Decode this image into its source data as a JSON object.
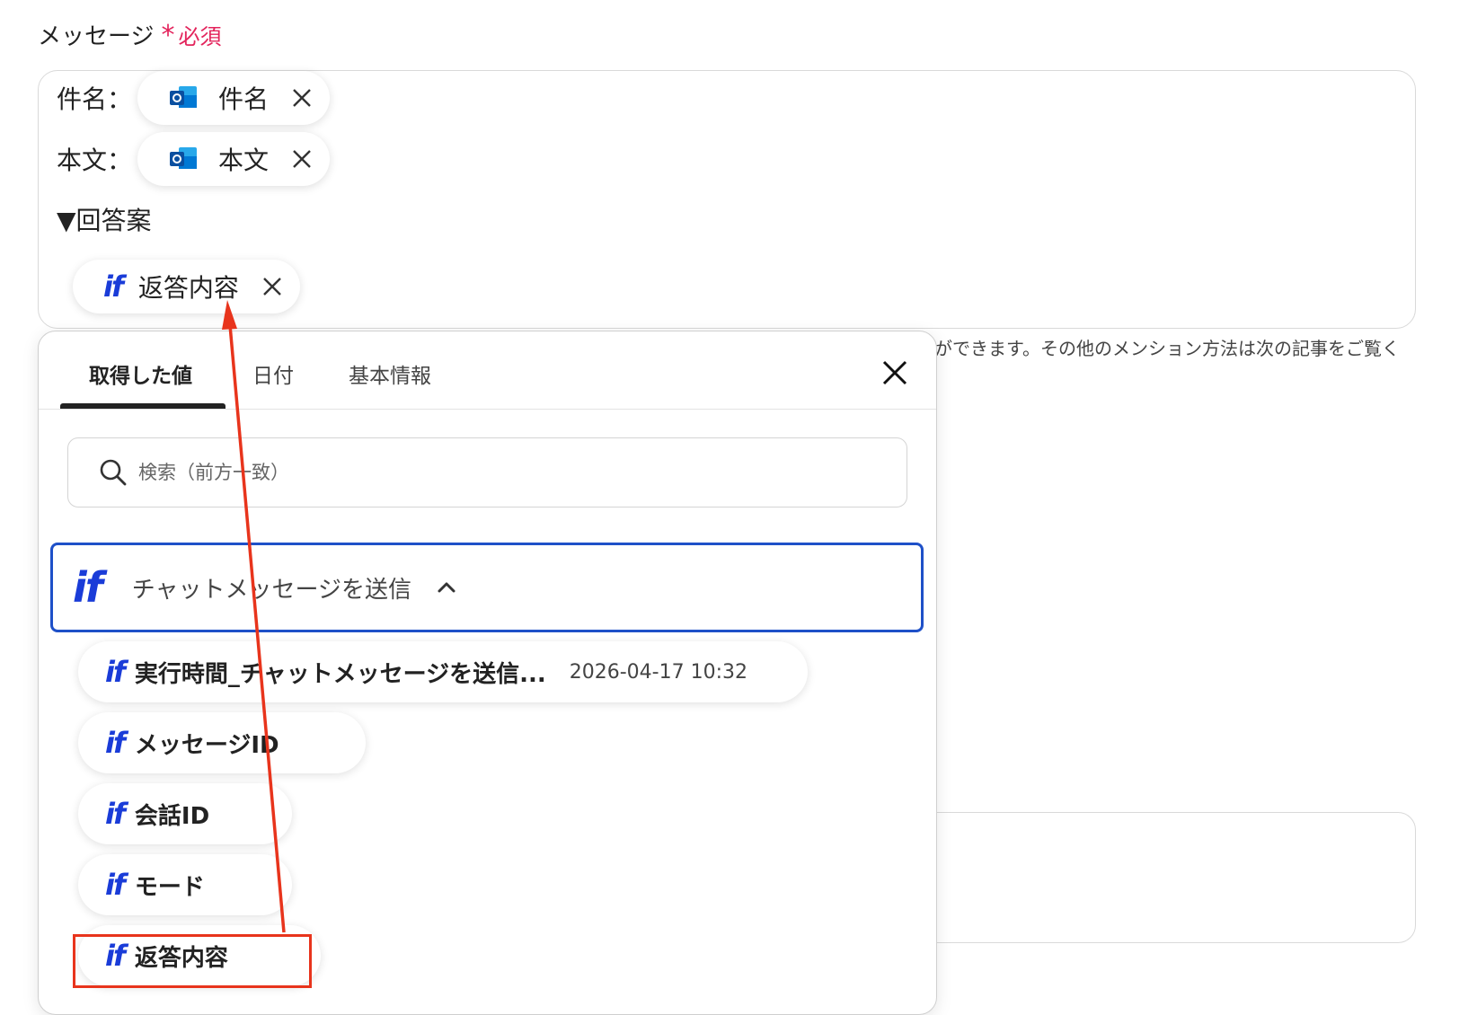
{
  "field": {
    "label": "メッセージ",
    "required_star": "*",
    "required_text": "必須"
  },
  "message": {
    "subject_label": "件名：",
    "subject_chip": "件名",
    "body_label": "本文：",
    "body_chip": "本文",
    "section_heading": "▼回答案",
    "answer_chip": "返答内容"
  },
  "helper_text": "ができます。その他のメンション方法は次の記事をご覧く",
  "dropdown": {
    "tabs": [
      {
        "label": "取得した値",
        "active": true
      },
      {
        "label": "日付",
        "active": false
      },
      {
        "label": "基本情報",
        "active": false
      }
    ],
    "search_placeholder": "検索（前方一致）",
    "group": {
      "icon": "if",
      "label": "チャットメッセージを送信"
    },
    "items": [
      {
        "icon": "if",
        "label": "実行時間_チャットメッセージを送信...",
        "value": "2026-04-17 10:32"
      },
      {
        "icon": "if",
        "label": "メッセージID"
      },
      {
        "icon": "if",
        "label": "会話ID"
      },
      {
        "icon": "if",
        "label": "モード"
      },
      {
        "icon": "if",
        "label": "返答内容"
      }
    ]
  },
  "colors": {
    "accent": "#1a3cd8",
    "required": "#e3245c",
    "annotation": "#e8341c",
    "group_border": "#1e50c8"
  },
  "icons": [
    "outlook-icon",
    "close-icon",
    "search-icon",
    "chevron-up-icon",
    "if-icon"
  ]
}
